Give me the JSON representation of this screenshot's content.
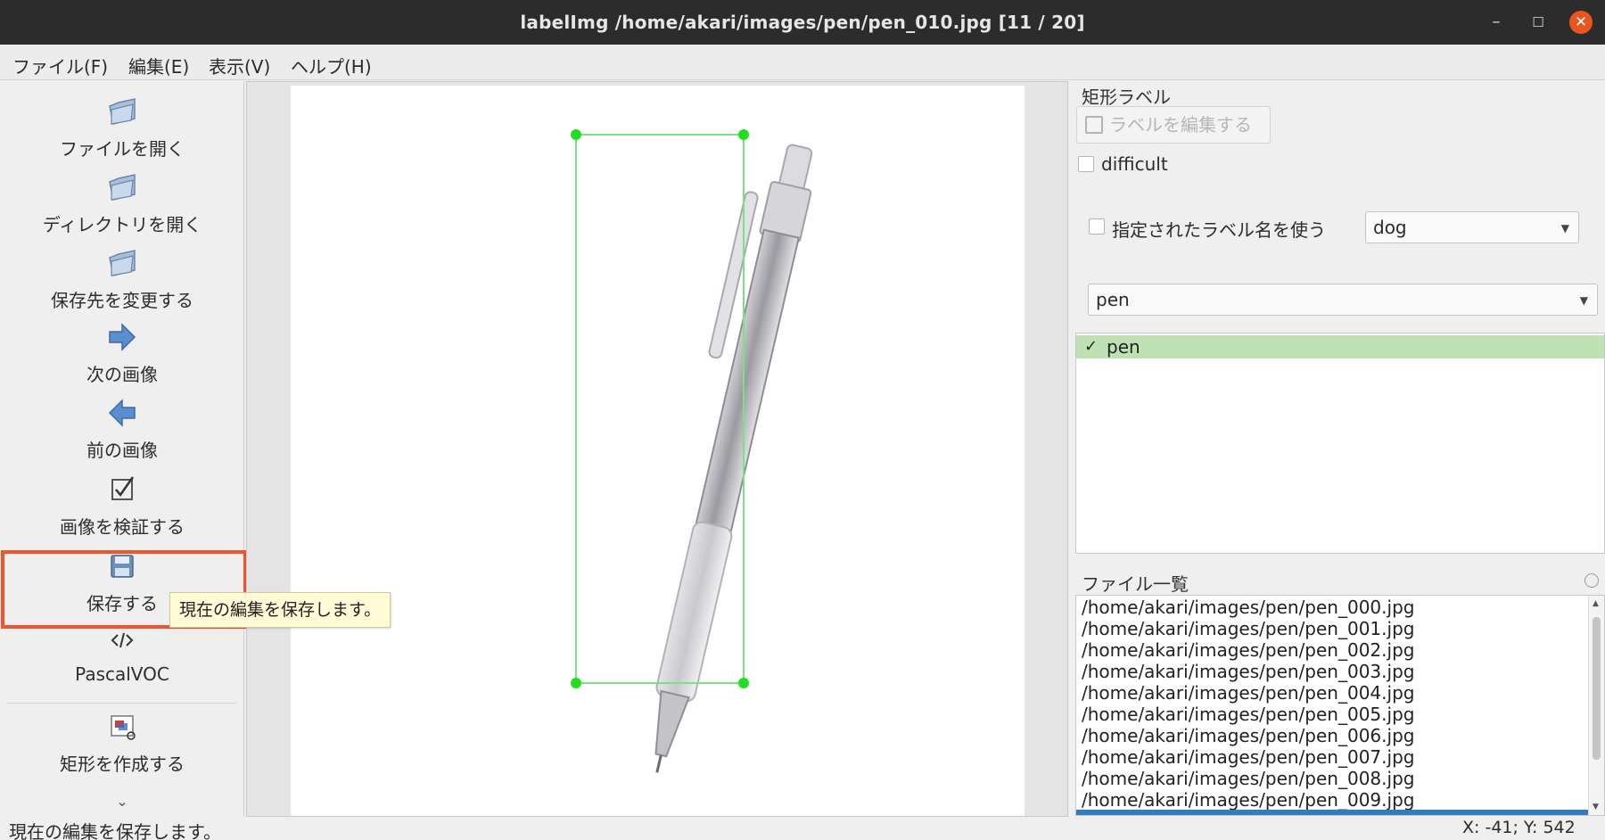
{
  "window": {
    "title": "labelImg /home/akari/images/pen/pen_010.jpg [11 / 20]",
    "controls": [
      "minimize",
      "maximize",
      "close"
    ]
  },
  "menu": {
    "items": [
      "ファイル(F)",
      "編集(E)",
      "表示(V)",
      "ヘルプ(H)"
    ]
  },
  "toolbar": {
    "open_file": "ファイルを開く",
    "open_dir": "ディレクトリを開く",
    "change_save_dir": "保存先を変更する",
    "next_image": "次の画像",
    "prev_image": "前の画像",
    "verify_image": "画像を検証する",
    "save": "保存する",
    "format": "PascalVOC",
    "create_rect": "矩形を作成する",
    "more": "⌄"
  },
  "tooltip": {
    "text": "現在の編集を保存します。"
  },
  "canvas": {
    "annotation_label": "pen",
    "box_color": "#22dd22"
  },
  "dock": {
    "box_labels_title": "矩形ラベル",
    "edit_label_button": "ラベルを編集する",
    "difficult_label": "difficult",
    "difficult_checked": false,
    "use_default_label": "指定されたラベル名を使う",
    "use_default_checked": false,
    "default_label_value": "dog",
    "label_combo_value": "pen",
    "labels": [
      {
        "name": "pen",
        "checked": true
      }
    ],
    "file_list_title": "ファイル一覧",
    "files": [
      "/home/akari/images/pen/pen_000.jpg",
      "/home/akari/images/pen/pen_001.jpg",
      "/home/akari/images/pen/pen_002.jpg",
      "/home/akari/images/pen/pen_003.jpg",
      "/home/akari/images/pen/pen_004.jpg",
      "/home/akari/images/pen/pen_005.jpg",
      "/home/akari/images/pen/pen_006.jpg",
      "/home/akari/images/pen/pen_007.jpg",
      "/home/akari/images/pen/pen_008.jpg",
      "/home/akari/images/pen/pen_009.jpg"
    ]
  },
  "status": {
    "message": "現在の編集を保存します。",
    "position": "X: -41; Y: 542"
  },
  "colors": {
    "accent_highlight": "#f0542a",
    "label_selected": "#bfe2b5",
    "file_selected": "#2f7dc0"
  }
}
